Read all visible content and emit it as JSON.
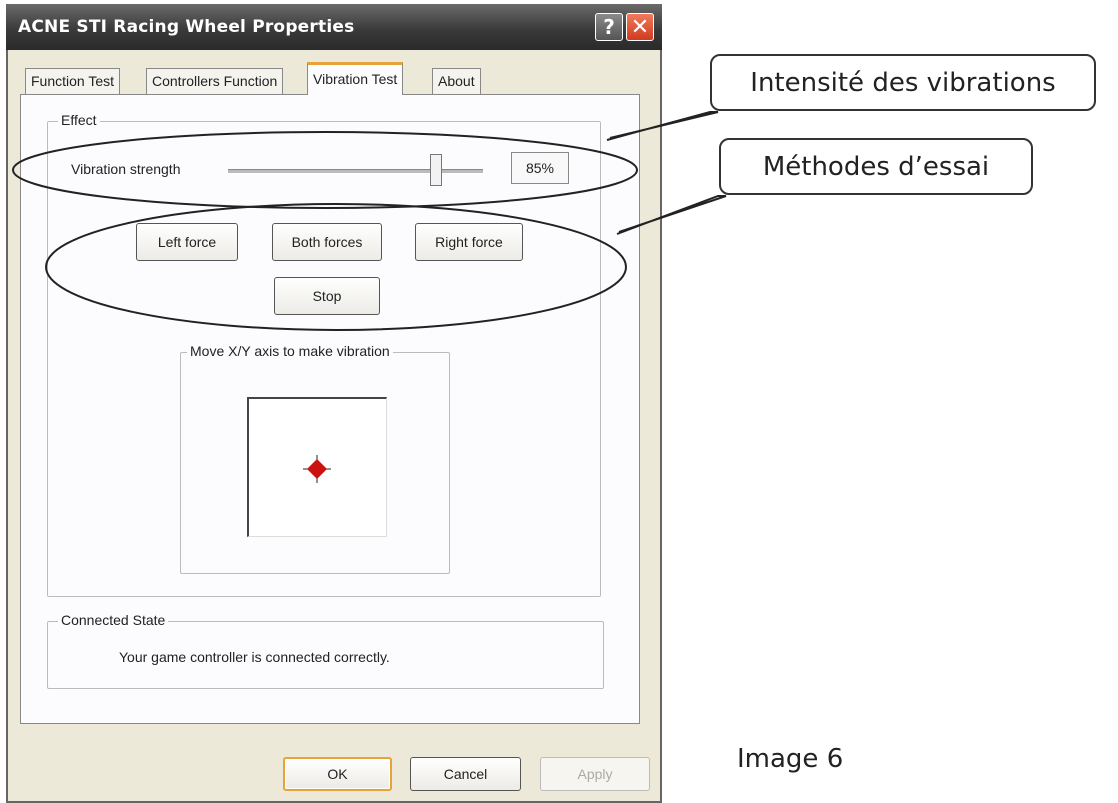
{
  "window": {
    "title": "ACNE STI Racing Wheel Properties",
    "help_label": "?",
    "close_label": "✕"
  },
  "tabs": [
    {
      "label": "Function Test",
      "active": false
    },
    {
      "label": "Controllers Function",
      "active": false
    },
    {
      "label": "Vibration Test",
      "active": true
    },
    {
      "label": "About",
      "active": false
    }
  ],
  "effect": {
    "group_title": "Effect",
    "strength_label": "Vibration strength",
    "strength_value": "85%",
    "strength_level": 0.85,
    "buttons": {
      "left": "Left force",
      "both": "Both forces",
      "right": "Right force",
      "stop": "Stop"
    },
    "xy_group_title": "Move X/Y axis to make vibration"
  },
  "connected": {
    "group_title": "Connected State",
    "status_text": "Your game controller is connected correctly."
  },
  "footer": {
    "ok": "OK",
    "cancel": "Cancel",
    "apply": "Apply"
  },
  "annotations": {
    "callout_intensity": "Intensité des vibrations",
    "callout_methods": "Méthodes d’essai",
    "image_label": "Image 6"
  },
  "colors": {
    "titlebar": "#3a3a3a",
    "close_button": "#d23a1f",
    "active_tab_accent": "#e8a23a",
    "marker": "#cc1111"
  },
  "icons": {
    "help": "help-icon",
    "close": "close-icon",
    "xy_marker": "crosshair-diamond-icon"
  }
}
